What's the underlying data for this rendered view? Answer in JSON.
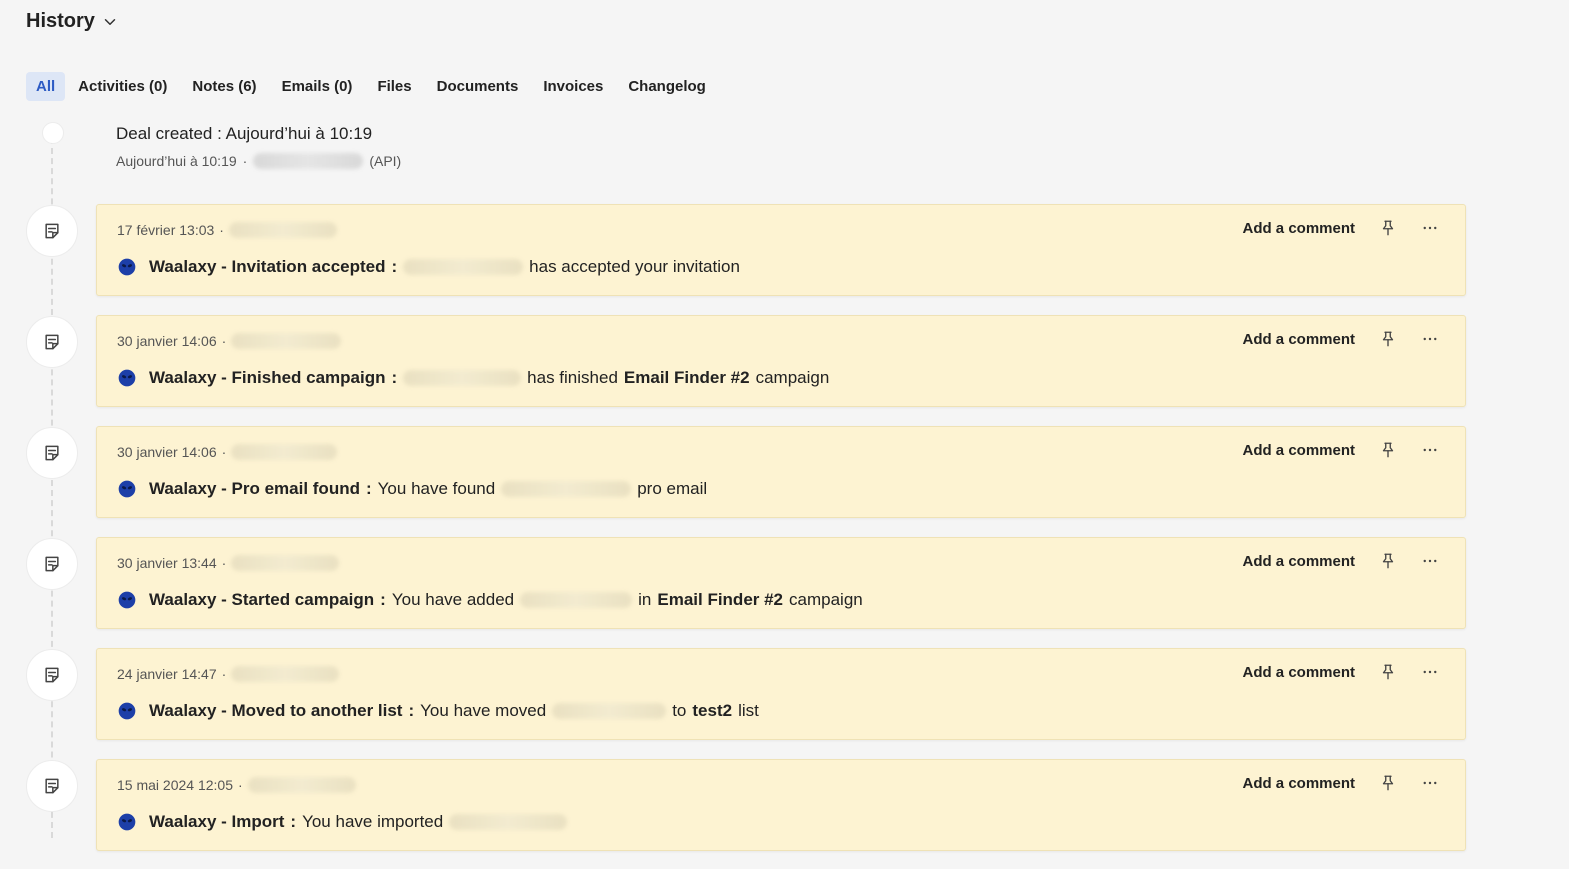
{
  "header": {
    "title": "History",
    "chevron_icon": "chevron-down-icon"
  },
  "tabs": [
    {
      "label": "All",
      "active": true
    },
    {
      "label": "Activities (0)"
    },
    {
      "label": "Notes (6)"
    },
    {
      "label": "Emails (0)"
    },
    {
      "label": "Files"
    },
    {
      "label": "Documents"
    },
    {
      "label": "Invoices"
    },
    {
      "label": "Changelog"
    }
  ],
  "deal": {
    "title_label": "Deal created",
    "title_value": "Aujourd’hui à 10:19",
    "meta_time": "Aujourd’hui à 10:19",
    "meta_source": "(API)"
  },
  "entries": [
    {
      "time": "17 février 13:03",
      "app": "Waalaxy - Invitation accepted",
      "text_after": "has accepted your invitation"
    },
    {
      "time": "30 janvier 14:06",
      "app": "Waalaxy - Finished campaign",
      "text_after": "has finished",
      "bold_2": "Email Finder #2",
      "text_end": "campaign"
    },
    {
      "time": "30 janvier 14:06",
      "app": "Waalaxy - Pro email found",
      "text_before": "You have found",
      "text_after": "pro email"
    },
    {
      "time": "30 janvier 13:44",
      "app": "Waalaxy - Started campaign",
      "text_before": "You have added",
      "text_after": "in",
      "bold_2": "Email Finder #2",
      "text_end": "campaign"
    },
    {
      "time": "24 janvier 14:47",
      "app": "Waalaxy - Moved to another list",
      "text_before": "You have moved",
      "text_after": "to",
      "bold_2": "test2",
      "text_end": "list"
    },
    {
      "time": "15 mai 2024 12:05",
      "app": "Waalaxy - Import",
      "text_before": "You have imported"
    }
  ],
  "card_actions": {
    "add_comment": "Add a comment",
    "pin_icon": "pin-icon",
    "more_icon": "more-icon"
  },
  "colors": {
    "card_bg": "#fdf3d2",
    "active_tab_bg": "#dde6f6",
    "active_tab_text": "#2d5bc4"
  }
}
